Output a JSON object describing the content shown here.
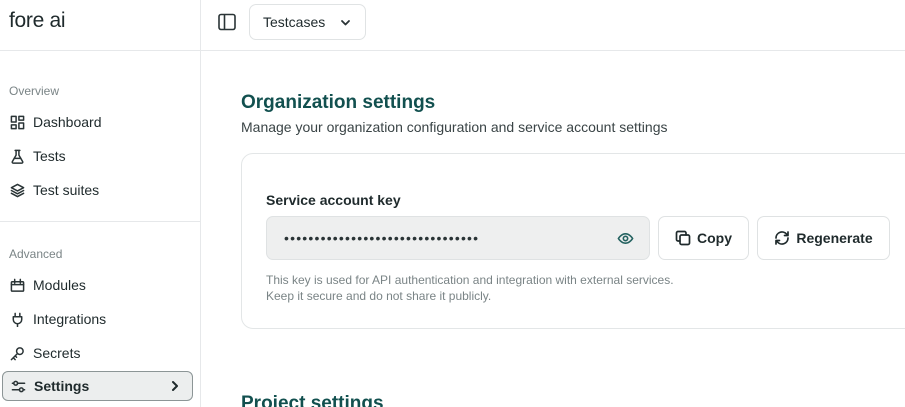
{
  "brand": "fore ai",
  "sidebar": {
    "overview_label": "Overview",
    "overview_items": [
      {
        "label": "Dashboard",
        "icon": "grid-icon"
      },
      {
        "label": "Tests",
        "icon": "flask-icon"
      },
      {
        "label": "Test suites",
        "icon": "layers-icon"
      }
    ],
    "advanced_label": "Advanced",
    "advanced_items": [
      {
        "label": "Modules",
        "icon": "calendar-box-icon"
      },
      {
        "label": "Integrations",
        "icon": "plug-icon"
      },
      {
        "label": "Secrets",
        "icon": "key-icon"
      },
      {
        "label": "Settings",
        "icon": "settings-sliders-icon",
        "active": true
      }
    ]
  },
  "topbar": {
    "project_select_value": "Testcases"
  },
  "main": {
    "title": "Organization settings",
    "subtitle": "Manage your organization configuration and service account settings",
    "service_key": {
      "label": "Service account key",
      "masked_value": "••••••••••••••••••••••••••••••••",
      "copy_label": "Copy",
      "regenerate_label": "Regenerate",
      "help_line_1": "This key is used for API authentication and integration with external services.",
      "help_line_2": "Keep it secure and do not share it publicly."
    },
    "next_section_title": "Project settings"
  }
}
